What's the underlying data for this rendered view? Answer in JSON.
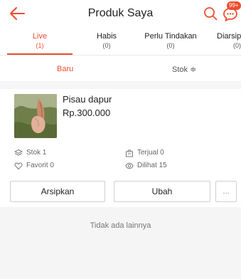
{
  "header": {
    "title": "Produk Saya",
    "chat_badge": "99+",
    "colors": {
      "accent": "#ee4d2d"
    },
    "icons": [
      "back-arrow-icon",
      "search-icon",
      "chat-icon"
    ]
  },
  "tabs": [
    {
      "label": "Live",
      "count": "(1)",
      "active": true
    },
    {
      "label": "Habis",
      "count": "(0)",
      "active": false
    },
    {
      "label": "Perlu Tindakan",
      "count": "(0)",
      "active": false
    },
    {
      "label": "Diarsip",
      "count": "(0)",
      "active": false
    }
  ],
  "sort": {
    "new_label": "Baru",
    "stock_label": "Stok ≑"
  },
  "product": {
    "name": "Pisau dapur",
    "price": "Rp.300.000",
    "stats": {
      "stock": "Stok 1",
      "sold": "Terjual 0",
      "favorite": "Favorit 0",
      "views": "Dilihat 15"
    },
    "actions": {
      "archive": "Arsipkan",
      "edit": "Ubah",
      "more": "..."
    }
  },
  "footer": {
    "no_more": "Tidak ada lainnya"
  }
}
